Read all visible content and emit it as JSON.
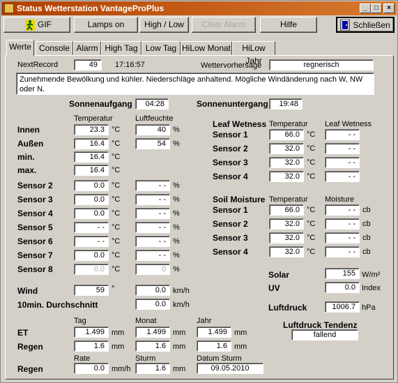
{
  "window": {
    "title": "Status Wetterstation VantageProPlus",
    "min": "_",
    "max": "□",
    "close": "×"
  },
  "toolbar": {
    "gif": "GIF",
    "lamps": "Lamps on",
    "highlow": "High / Low",
    "clear_alarm": "Clear Alarm",
    "hilfe": "Hilfe",
    "schliessen": "Schließen"
  },
  "tabs": [
    "Werte",
    "Console",
    "Alarm",
    "High Tag",
    "Low Tag",
    "HiLow Monat",
    "HiLow Jahr"
  ],
  "header": {
    "next_record_label": "NextRecord",
    "next_record": "49",
    "time": "17:16:57",
    "forecast_label": "Wettervorhersage",
    "forecast": "regnerisch",
    "forecast_text": "Zunehmende Bewölkung und kühler. Niederschläge anhaltend. Mögliche Windänderung nach W, NW oder N."
  },
  "sun": {
    "rise_label": "Sonnenaufgang",
    "rise": "04:28",
    "set_label": "Sonnenuntergang",
    "set": "19:48"
  },
  "cols": {
    "temp": "Temperatur",
    "hum": "Luftfeuchte"
  },
  "units": {
    "c": "°C",
    "pct": "%",
    "deg": "°",
    "kmh": "km/h",
    "mm": "mm",
    "mmh": "mm/h",
    "cb": "cb",
    "wm2": "W/m²",
    "index": "Index",
    "hpa": "hPa"
  },
  "rows": [
    {
      "label": "Innen",
      "temp": "23.3",
      "hum": "40"
    },
    {
      "label": "Außen",
      "temp": "16.4",
      "hum": "54"
    },
    {
      "label": "min.",
      "temp": "16.4"
    },
    {
      "label": "max.",
      "temp": "16.4"
    },
    {
      "label": "Sensor 2",
      "temp": "0.0",
      "hum": "- -"
    },
    {
      "label": "Sensor 3",
      "temp": "0.0",
      "hum": "- -"
    },
    {
      "label": "Sensor 4",
      "temp": "0.0",
      "hum": "- -"
    },
    {
      "label": "Sensor 5",
      "temp": "- -",
      "hum": "- -"
    },
    {
      "label": "Sensor 6",
      "temp": "- -",
      "hum": "- -"
    },
    {
      "label": "Sensor 7",
      "temp": "0.0",
      "hum": "- -"
    },
    {
      "label": "Sensor 8",
      "temp": "0.0",
      "hum": "0"
    }
  ],
  "leaf": {
    "title": "Leaf Wetness",
    "col_temp": "Temperatur",
    "col_wet": "Leaf Wetness",
    "rows": [
      {
        "label": "Sensor 1",
        "temp": "66.0",
        "val": "- -"
      },
      {
        "label": "Sensor 2",
        "temp": "32.0",
        "val": "- -"
      },
      {
        "label": "Sensor 3",
        "temp": "32.0",
        "val": "- -"
      },
      {
        "label": "Sensor 4",
        "temp": "32.0",
        "val": "- -"
      }
    ]
  },
  "soil": {
    "title": "Soil Moisture",
    "col_temp": "Temperatur",
    "col_moist": "Moisture",
    "rows": [
      {
        "label": "Sensor 1",
        "temp": "66.0",
        "val": "- -"
      },
      {
        "label": "Sensor 2",
        "temp": "32.0",
        "val": "- -"
      },
      {
        "label": "Sensor 3",
        "temp": "32.0",
        "val": "- -"
      },
      {
        "label": "Sensor 4",
        "temp": "32.0",
        "val": "- -"
      }
    ]
  },
  "wind": {
    "label": "Wind",
    "dir": "59",
    "speed": "0.0",
    "avg_label": "10min. Durchschnitt",
    "avg": "0.0"
  },
  "solar": {
    "label": "Solar",
    "value": "155",
    "uv_label": "UV",
    "uv": "0.0",
    "press_label": "Luftdruck",
    "press": "1006.7",
    "trend_label": "Luftdruck Tendenz",
    "trend": "fallend"
  },
  "rain": {
    "col_tag": "Tag",
    "col_monat": "Monat",
    "col_jahr": "Jahr",
    "et_label": "ET",
    "et": [
      "1.499",
      "1.499",
      "1.499"
    ],
    "regen_label": "Regen",
    "regen": [
      "1.6",
      "1.6",
      "1.6"
    ],
    "col_rate": "Rate",
    "col_sturm": "Sturm",
    "col_datum": "Datum Sturm",
    "rate": "0.0",
    "sturm": "1.6",
    "datum": "09.05.2010"
  }
}
